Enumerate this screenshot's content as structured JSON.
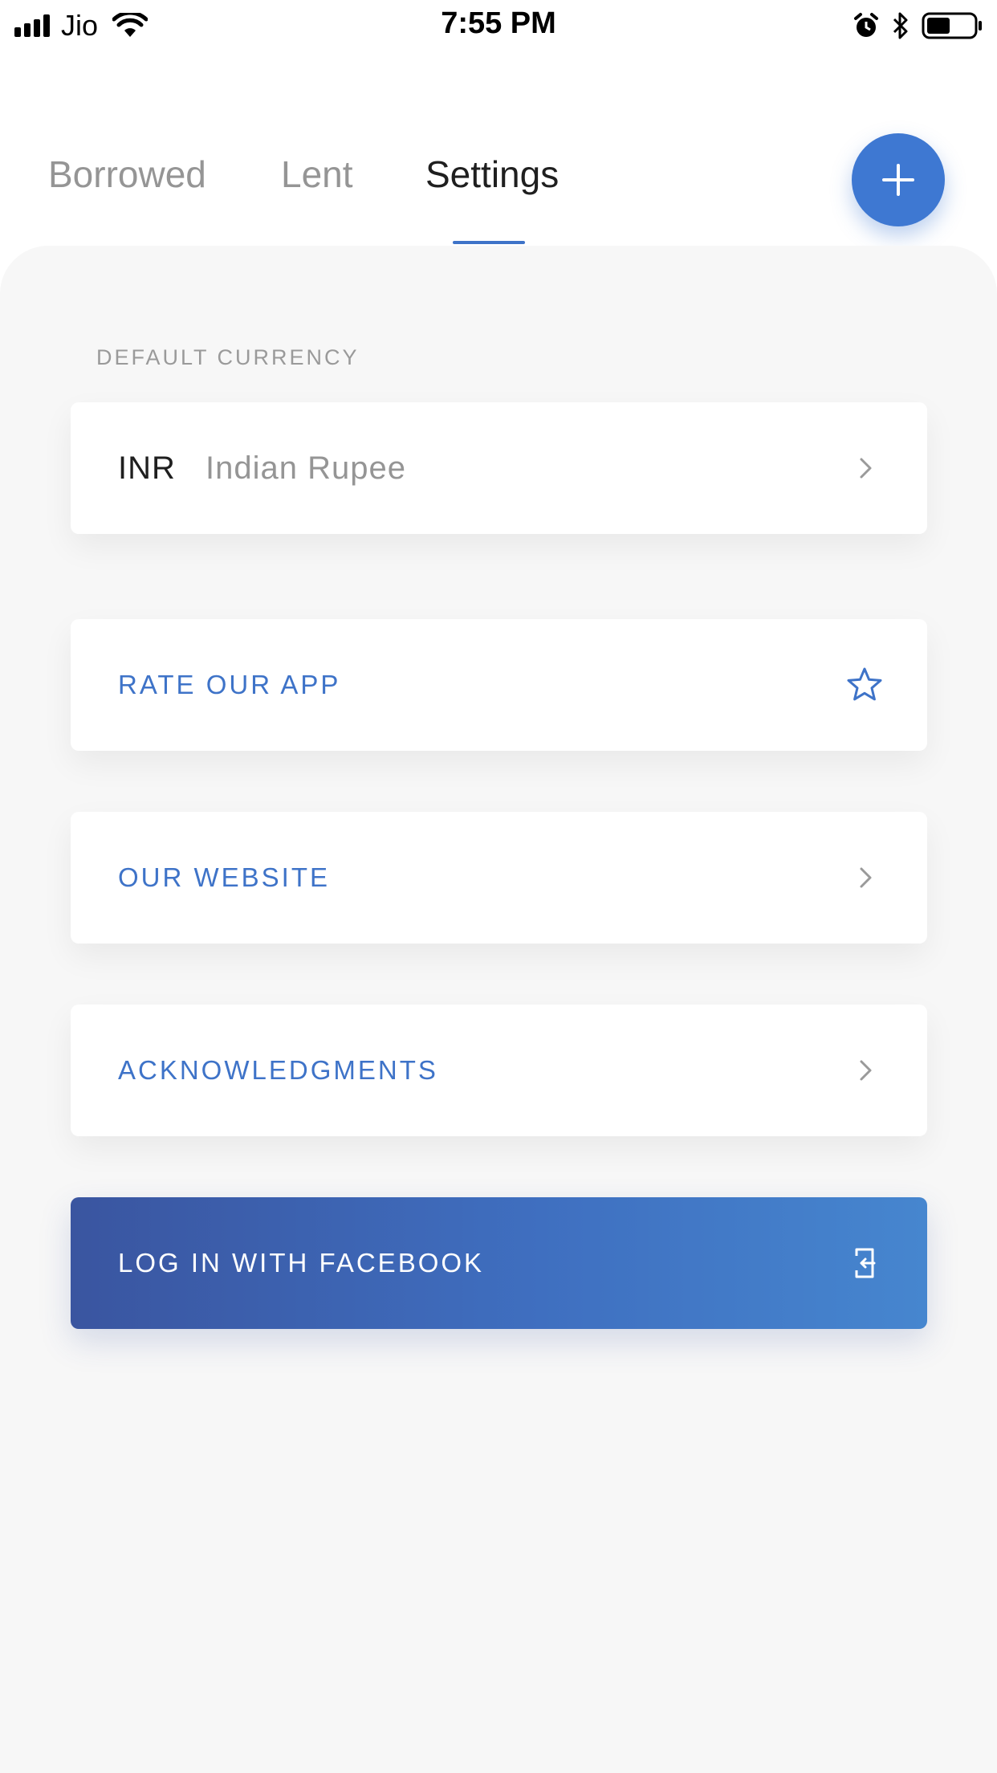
{
  "status_bar": {
    "carrier": "Jio",
    "time": "7:55 PM",
    "icons": [
      "signal-icon",
      "wifi-icon",
      "alarm-icon",
      "bluetooth-icon",
      "battery-icon"
    ]
  },
  "tabs": [
    {
      "label": "Borrowed",
      "active": false
    },
    {
      "label": "Lent",
      "active": false
    },
    {
      "label": "Settings",
      "active": true
    }
  ],
  "fab": {
    "icon": "plus-icon"
  },
  "settings": {
    "default_currency_label": "DEFAULT CURRENCY",
    "currency_code": "INR",
    "currency_name": "Indian Rupee",
    "rate_app_label": "RATE OUR APP",
    "website_label": "OUR WEBSITE",
    "acknowledgments_label": "ACKNOWLEDGMENTS",
    "facebook_login_label": "LOG IN WITH FACEBOOK"
  },
  "colors": {
    "accent": "#3e73c8",
    "fab": "#3e78d2",
    "panel_background": "#f7f7f7",
    "facebook_gradient_start": "#3a55a0",
    "facebook_gradient_end": "#4686cf"
  }
}
